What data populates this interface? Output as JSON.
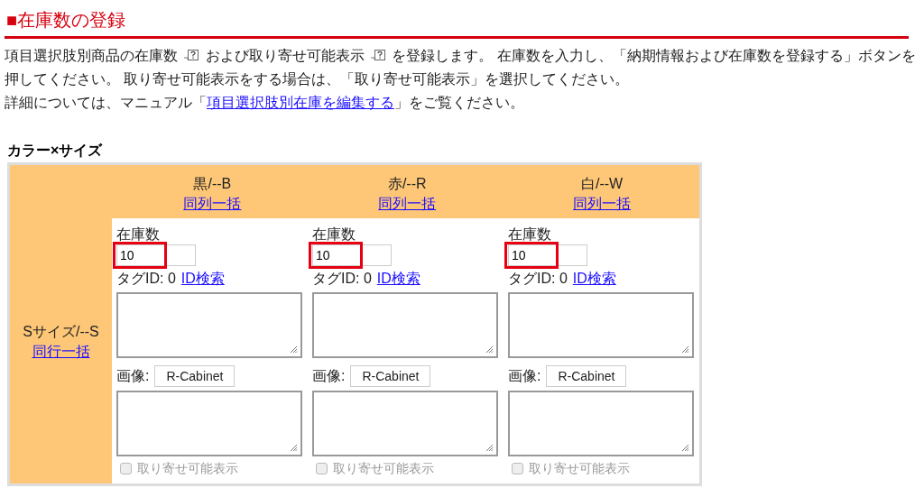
{
  "heading": "■在庫数の登録",
  "intro": [
    {
      "kind": "text",
      "text": "項目選択肢別商品の在庫数 "
    },
    {
      "kind": "help"
    },
    {
      "kind": "text",
      "text": " および取り寄せ可能表示 "
    },
    {
      "kind": "help"
    },
    {
      "kind": "text",
      "text": " を登録します。 在庫数を入力し、「納期情報および在庫数を登録する」ボタンを押してください。 取り寄せ可能表示をする場合は、「取り寄せ可能表示」を選択してください。"
    },
    {
      "kind": "break"
    },
    {
      "kind": "text",
      "text": "詳細については、マニュアル「"
    },
    {
      "kind": "link",
      "text": "項目選択肢別在庫を編集する"
    },
    {
      "kind": "text",
      "text": "」をご覧ください。"
    }
  ],
  "matrix_title": "カラー×サイズ",
  "columns": [
    {
      "label": "黒/--B",
      "link": "同列一括"
    },
    {
      "label": "赤/--R",
      "link": "同列一括"
    },
    {
      "label": "白/--W",
      "link": "同列一括"
    }
  ],
  "rows": [
    {
      "label": "Sサイズ/--S",
      "link": "同行一括",
      "cells": [
        {
          "stock_label": "在庫数",
          "stock": "10",
          "highlighted": true,
          "tag_label": "タグID: 0",
          "tag_link": "ID検索",
          "image_label": "画像:",
          "image_button": "R-Cabinet",
          "order_label": "取り寄せ可能表示",
          "checked": false,
          "disabled": true
        },
        {
          "stock_label": "在庫数",
          "stock": "10",
          "highlighted": true,
          "tag_label": "タグID: 0",
          "tag_link": "ID検索",
          "image_label": "画像:",
          "image_button": "R-Cabinet",
          "order_label": "取り寄せ可能表示",
          "checked": false,
          "disabled": true
        },
        {
          "stock_label": "在庫数",
          "stock": "10",
          "highlighted": true,
          "tag_label": "タグID: 0",
          "tag_link": "ID検索",
          "image_label": "画像:",
          "image_button": "R-Cabinet",
          "order_label": "取り寄せ可能表示",
          "checked": false,
          "disabled": true
        }
      ]
    }
  ]
}
